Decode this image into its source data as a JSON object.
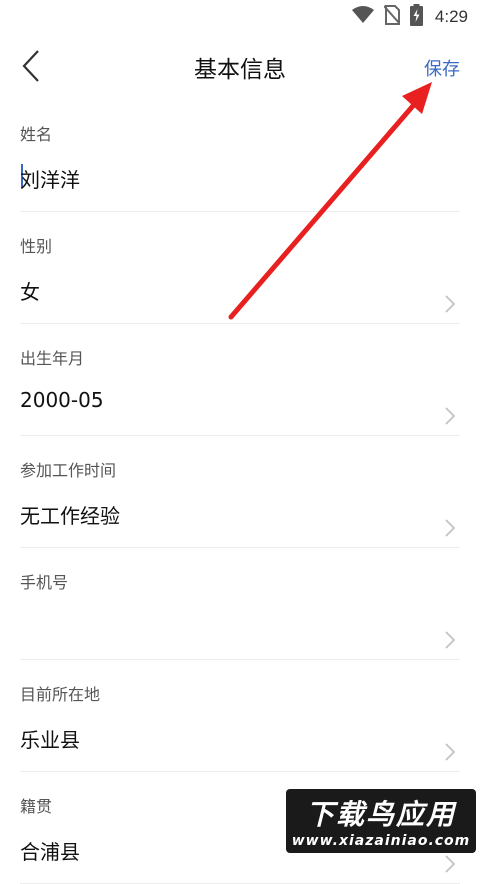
{
  "status_bar": {
    "time": "4:29"
  },
  "header": {
    "title": "基本信息",
    "save_label": "保存"
  },
  "form": {
    "fields": [
      {
        "label": "姓名",
        "value": "刘洋洋",
        "has_chevron": false
      },
      {
        "label": "性别",
        "value": "女",
        "has_chevron": true
      },
      {
        "label": "出生年月",
        "value": "2000-05",
        "has_chevron": true
      },
      {
        "label": "参加工作时间",
        "value": "无工作经验",
        "has_chevron": true
      },
      {
        "label": "手机号",
        "value": "",
        "has_chevron": true
      },
      {
        "label": "目前所在地",
        "value": "乐业县",
        "has_chevron": true
      },
      {
        "label": "籍贯",
        "value": "合浦县",
        "has_chevron": true
      }
    ]
  },
  "watermark": {
    "main": "下载鸟应用",
    "sub": "www.xiazainiao.com"
  },
  "colors": {
    "accent": "#3a6bc4",
    "arrow": "#e8201f"
  }
}
